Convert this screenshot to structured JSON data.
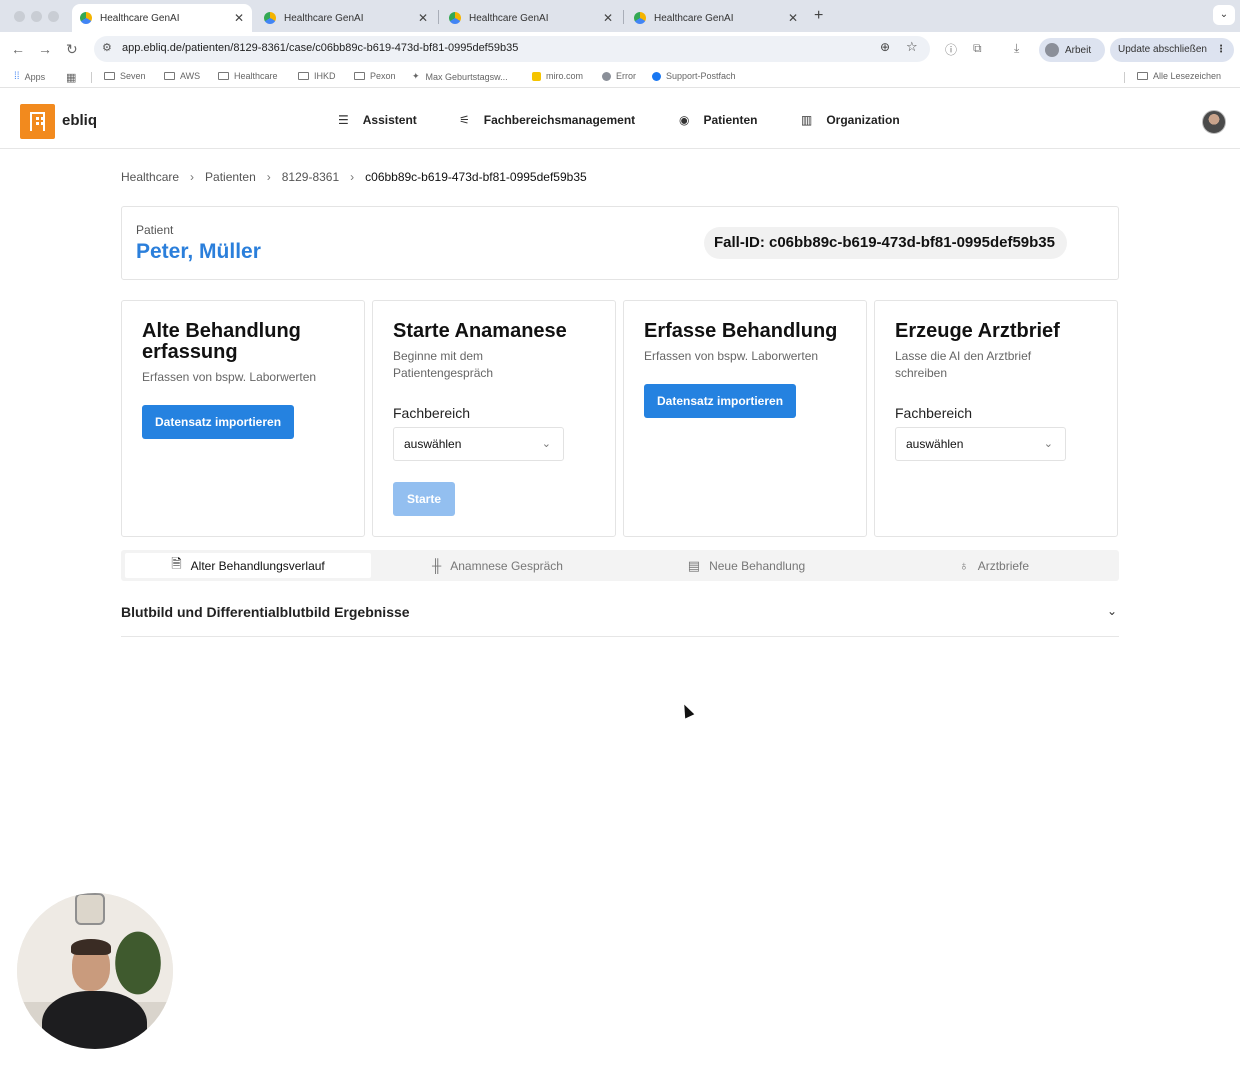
{
  "browser": {
    "tabs": [
      {
        "title": "Healthcare GenAI",
        "active": true
      },
      {
        "title": "Healthcare GenAI",
        "active": false
      },
      {
        "title": "Healthcare GenAI",
        "active": false
      },
      {
        "title": "Healthcare GenAI",
        "active": false
      }
    ],
    "url": "app.ebliq.de/patienten/8129-8361/case/c06bb89c-b619-473d-bf81-0995def59b35",
    "profile_label": "Arbeit",
    "update_label": "Update abschließen",
    "bookmarks": [
      "Apps",
      "Seven",
      "AWS",
      "Healthcare",
      "IHKD",
      "Pexon",
      "Max Geburtstagsw...",
      "miro.com",
      "Error",
      "Support-Postfach"
    ],
    "all_bookmarks_label": "Alle Lesezeichen"
  },
  "app": {
    "brand": "ebliq",
    "nav": [
      {
        "label": "Assistent",
        "icon": "chart-icon"
      },
      {
        "label": "Fachbereichsmanagement",
        "icon": "sliders-icon"
      },
      {
        "label": "Patienten",
        "icon": "user-circle-icon"
      },
      {
        "label": "Organization",
        "icon": "building-icon"
      }
    ]
  },
  "breadcrumb": [
    "Healthcare",
    "Patienten",
    "8129-8361",
    "c06bb89c-b619-473d-bf81-0995def59b35"
  ],
  "patient": {
    "label": "Patient",
    "name": "Peter, Müller",
    "case_id": "Fall-ID: c06bb89c-b619-473d-bf81-0995def59b35"
  },
  "cards": [
    {
      "title": "Alte Behandlung erfassung",
      "description": "Erfassen von bspw. Laborwerten",
      "button": "Datensatz importieren"
    },
    {
      "title": "Starte Anamanese",
      "description": "Beginne mit dem Patientengespräch",
      "field_label": "Fachbereich",
      "select_value": "auswählen",
      "button": "Starte"
    },
    {
      "title": "Erfasse Behandlung",
      "description": "Erfassen von bspw. Laborwerten",
      "button": "Datensatz importieren"
    },
    {
      "title": "Erzeuge Arztbrief",
      "description": "Lasse die AI den Arztbrief schreiben",
      "field_label": "Fachbereich",
      "select_value": "auswählen"
    }
  ],
  "tabs": [
    {
      "label": "Alter Behandlungsverlauf",
      "active": true,
      "icon": "document-icon"
    },
    {
      "label": "Anamnese Gespräch",
      "active": false,
      "icon": "waveform-icon"
    },
    {
      "label": "Neue Behandlung",
      "active": false,
      "icon": "newspaper-icon"
    },
    {
      "label": "Arztbriefe",
      "active": false,
      "icon": "stethoscope-icon"
    }
  ],
  "accordion": {
    "title": "Blutbild und Differentialblutbild Ergebnisse",
    "expanded": false
  },
  "colors": {
    "accent": "#2582e0",
    "patient_name": "#2b7fdb",
    "logo": "#f28a1e",
    "disabled_button": "#93bff0"
  }
}
